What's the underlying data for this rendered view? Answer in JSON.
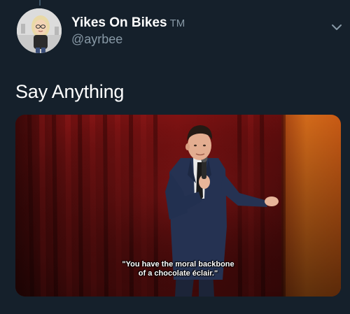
{
  "user": {
    "display_name": "Yikes On Bikes",
    "tm": "TM",
    "handle": "@ayrbee"
  },
  "tweet": {
    "text": "Say Anything"
  },
  "media": {
    "subtitle_line1": "\"You have the moral backbone",
    "subtitle_line2": "of a chocolate éclair.\""
  },
  "icons": {
    "menu": "chevron-down-icon"
  },
  "colors": {
    "background": "#15202b",
    "secondary_text": "#8899a6",
    "curtain_red": "#8b1414",
    "curtain_orange": "#d26a1a"
  }
}
